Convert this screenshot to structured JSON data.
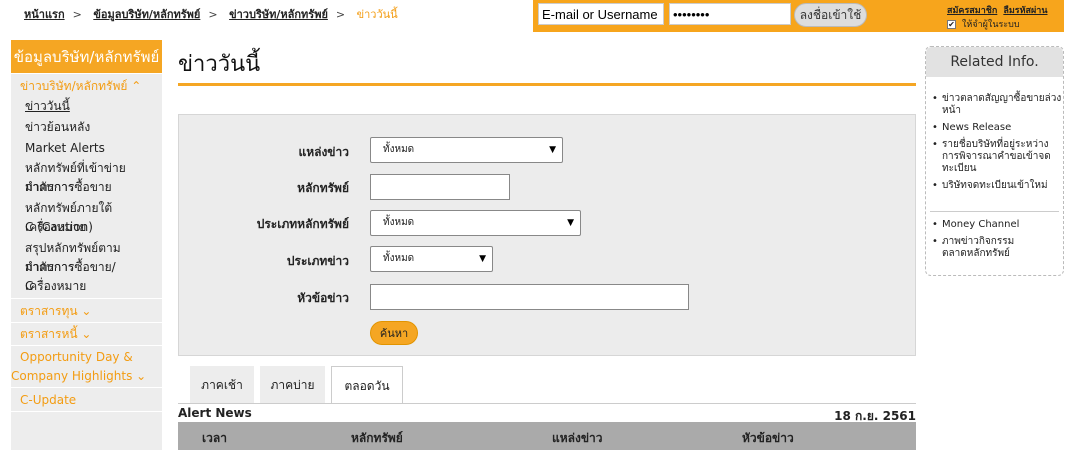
{
  "breadcrumb": [
    "หน้าแรก",
    "ข้อมูลบริษัท/หลักทรัพย์",
    "ข่าวบริษัท/หลักทรัพย์",
    "ข่าววันนี้"
  ],
  "login": {
    "username_value": "E-mail or Username",
    "password_value": "••••••••",
    "login_button": "ลงชื่อเข้าใช้",
    "register_link": "สมัครสมาชิก",
    "forgot_link": "ลืมรหัสผ่าน",
    "remember_label": "ให้จำผู้ในระบบ",
    "remember_checked": true
  },
  "sidebar": {
    "header": "ข้อมูลบริษัท/หลักทรัพย์",
    "section1": "ข่าวบริษัท/หลักทรัพย์ ⌃",
    "items": {
      "today": "ข่าววันนี้",
      "history": "ข่าวย้อนหลัง",
      "alerts": "Market Alerts",
      "trading_1": "หลักทรัพย์ที่เข้าข่ายมาตรการ",
      "trading_2": "กำกับการซื้อขาย",
      "caution_1": "หลักทรัพย์ภายใต้เครื่องหมาย",
      "caution_2": "C (Caution)",
      "summary_1": "สรุปหลักทรัพย์ตามมาตรการ",
      "summary_2": "กำกับการซื้อขาย/เครื่องหมาย",
      "summary_3": "C"
    },
    "fund": "ตราสารทุน ⌄",
    "debt": "ตราสารหนี้ ⌄",
    "oppday_1": "Opportunity Day &",
    "oppday_2": "Company Highlights ⌄",
    "cupdate": "C-Update"
  },
  "page_title": "ข่าววันนี้",
  "form": {
    "source_label": "แหล่งข่าว",
    "source_value": "ทั้งหมด",
    "security_label": "หลักทรัพย์",
    "security_value": "",
    "sectype_label": "ประเภทหลักทรัพย์",
    "sectype_value": "ทั้งหมด",
    "newstype_label": "ประเภทข่าว",
    "newstype_value": "ทั้งหมด",
    "headline_label": "หัวข้อข่าว",
    "headline_value": "",
    "search_button": "ค้นหา"
  },
  "tabs": [
    "ภาคเช้า",
    "ภาคบ่าย",
    "ตลอดวัน"
  ],
  "active_tab": "ตลอดวัน",
  "results": {
    "title": "Alert News",
    "date": "18 ก.ย. 2561",
    "columns": [
      "เวลา",
      "หลักทรัพย์",
      "แหล่งข่าว",
      "หัวข้อข่าว"
    ]
  },
  "related": {
    "title": "Related Info.",
    "group1": [
      "ข่าวตลาดสัญญาซื้อขายล่วงหน้า",
      "News Release",
      "รายชื่อบริษัทที่อยู่ระหว่างการพิจารณาคำขอเข้าจดทะเบียน",
      "บริษัทจดทะเบียนเข้าใหม่"
    ],
    "group2": [
      "Money Channel",
      "ภาพข่าวกิจกรรมตลาดหลักทรัพย์"
    ]
  },
  "colors": {
    "accent": "#f5a623",
    "panel": "#ececec",
    "header_gray": "#aaaaaa"
  }
}
